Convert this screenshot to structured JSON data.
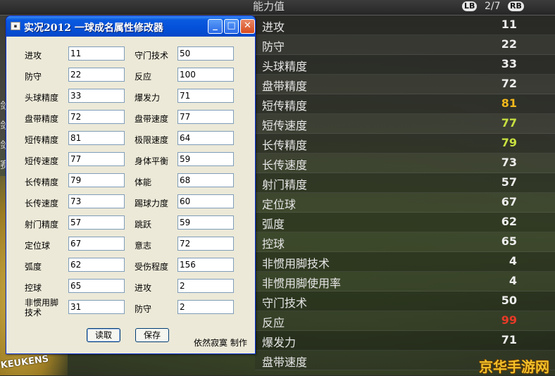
{
  "game": {
    "header_title": "能力值",
    "lb": "LB",
    "rb": "RB",
    "page": "2/7",
    "watermark": "京华手游网",
    "sponsor_text": "KEUKENS",
    "left_clip_chars": [
      "敛",
      "敛",
      "敛",
      "赛"
    ],
    "stats": [
      {
        "name": "进攻",
        "value": "11",
        "color": "#eeeeee"
      },
      {
        "name": "防守",
        "value": "22",
        "color": "#eeeeee"
      },
      {
        "name": "头球精度",
        "value": "33",
        "color": "#eeeeee"
      },
      {
        "name": "盘带精度",
        "value": "72",
        "color": "#eeeeee"
      },
      {
        "name": "短传精度",
        "value": "81",
        "color": "#f2b81c"
      },
      {
        "name": "短传速度",
        "value": "77",
        "color": "#c8e040"
      },
      {
        "name": "长传精度",
        "value": "79",
        "color": "#c8e040"
      },
      {
        "name": "长传速度",
        "value": "73",
        "color": "#eeeeee"
      },
      {
        "name": "射门精度",
        "value": "57",
        "color": "#eeeeee"
      },
      {
        "name": "定位球",
        "value": "67",
        "color": "#eeeeee"
      },
      {
        "name": "弧度",
        "value": "62",
        "color": "#eeeeee"
      },
      {
        "name": "控球",
        "value": "65",
        "color": "#eeeeee"
      },
      {
        "name": "非惯用脚技术",
        "value": "4",
        "color": "#eeeeee"
      },
      {
        "name": "非惯用脚使用率",
        "value": "4",
        "color": "#eeeeee"
      },
      {
        "name": "守门技术",
        "value": "50",
        "color": "#eeeeee"
      },
      {
        "name": "反应",
        "value": "99",
        "color": "#e83a28"
      },
      {
        "name": "爆发力",
        "value": "71",
        "color": "#eeeeee"
      },
      {
        "name": "盘带速度",
        "value": "",
        "color": "#eeeeee"
      }
    ]
  },
  "dialog": {
    "title": "实况2012 一球成名属性修改器",
    "min_glyph": "_",
    "max_glyph": "□",
    "close_glyph": "✕",
    "left_fields": [
      {
        "label": "进攻",
        "value": "11"
      },
      {
        "label": "防守",
        "value": "22"
      },
      {
        "label": "头球精度",
        "value": "33"
      },
      {
        "label": "盘带精度",
        "value": "72"
      },
      {
        "label": "短传精度",
        "value": "81"
      },
      {
        "label": "短传速度",
        "value": "77"
      },
      {
        "label": "长传精度",
        "value": "79"
      },
      {
        "label": "长传速度",
        "value": "73"
      },
      {
        "label": "射门精度",
        "value": "57"
      },
      {
        "label": "定位球",
        "value": "67"
      },
      {
        "label": "弧度",
        "value": "62"
      },
      {
        "label": "控球",
        "value": "65"
      },
      {
        "label": "非惯用脚技术",
        "value": "31"
      }
    ],
    "right_fields": [
      {
        "label": "守门技术",
        "value": "50"
      },
      {
        "label": "反应",
        "value": "100"
      },
      {
        "label": "爆发力",
        "value": "71"
      },
      {
        "label": "盘带速度",
        "value": "77"
      },
      {
        "label": "极限速度",
        "value": "64"
      },
      {
        "label": "身体平衡",
        "value": "59"
      },
      {
        "label": "体能",
        "value": "68"
      },
      {
        "label": "踢球力度",
        "value": "60"
      },
      {
        "label": "跳跃",
        "value": "59"
      },
      {
        "label": "意志",
        "value": "72"
      },
      {
        "label": "受伤程度",
        "value": "156"
      },
      {
        "label": "进攻",
        "value": "2"
      },
      {
        "label": "防守",
        "value": "2"
      }
    ],
    "read_button": "读取",
    "save_button": "保存",
    "credit": "依然寂寞 制作"
  }
}
